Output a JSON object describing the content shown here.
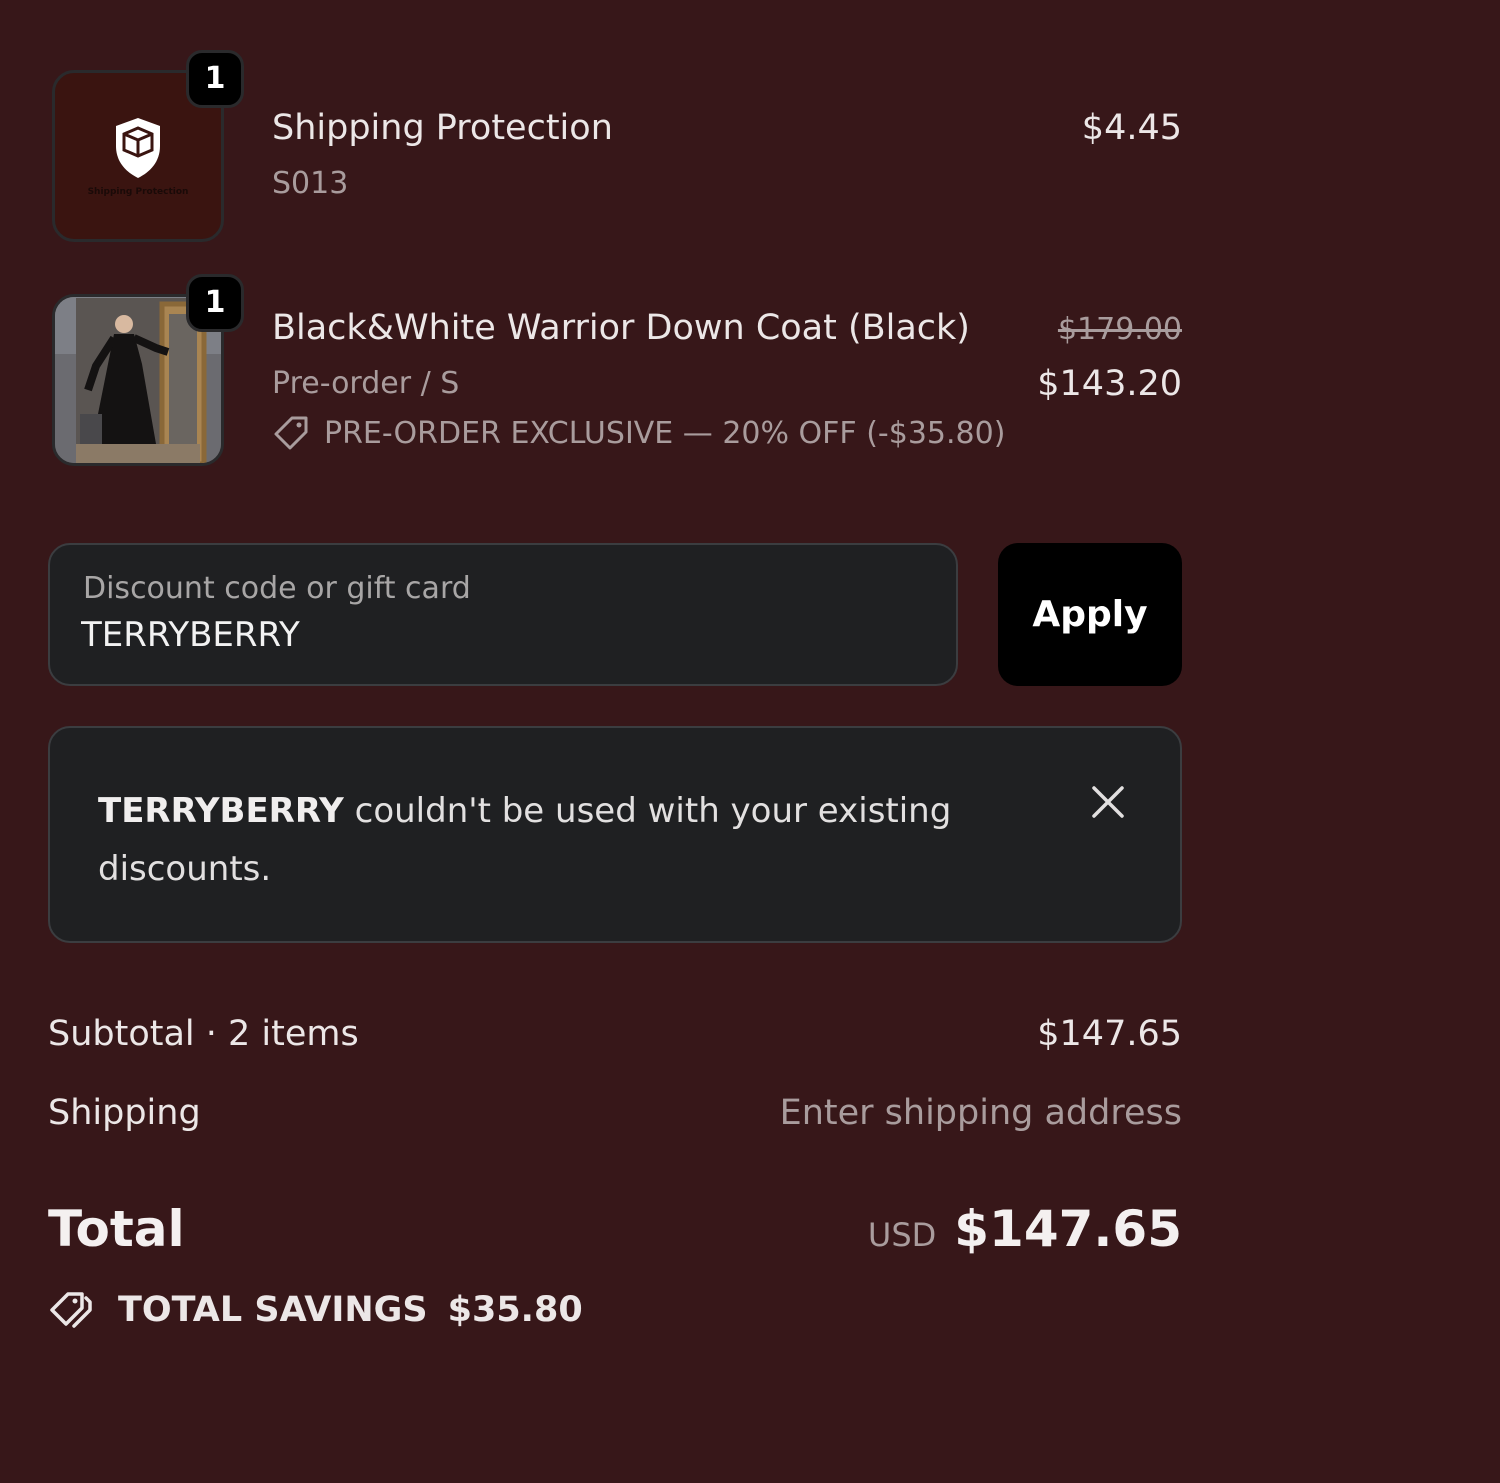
{
  "items": [
    {
      "title": "Shipping Protection",
      "subtitle": "S013",
      "quantity": "1",
      "price": "$4.45",
      "thumb_icon": "shield-box-icon",
      "thumb_caption": "Shipping Protection"
    },
    {
      "title": "Black&White Warrior Down Coat (Black)",
      "subtitle": "Pre-order / S",
      "quantity": "1",
      "original_price": "$179.00",
      "price": "$143.20",
      "discount": "PRE-ORDER EXCLUSIVE — 20% OFF (-$35.80)",
      "discount_icon": "tag-icon",
      "thumb_image": "coat-photo"
    }
  ],
  "discount_code": {
    "label": "Discount code or gift card",
    "value": "TERRYBERRY",
    "button": "Apply"
  },
  "error_banner": {
    "code": "TERRYBERRY",
    "message": " couldn't be used with your existing discounts.",
    "close_icon": "close-icon"
  },
  "summary": {
    "subtotal_label": "Subtotal · 2 items",
    "subtotal_value": "$147.65",
    "shipping_label": "Shipping",
    "shipping_value": "Enter shipping address",
    "total_label": "Total",
    "currency": "USD",
    "total_value": "$147.65",
    "savings_label": "TOTAL SAVINGS",
    "savings_value": "$35.80",
    "savings_icon": "tags-icon"
  },
  "colors": {
    "background": "#371719",
    "field_background": "#1f2022",
    "button": "#000000"
  }
}
